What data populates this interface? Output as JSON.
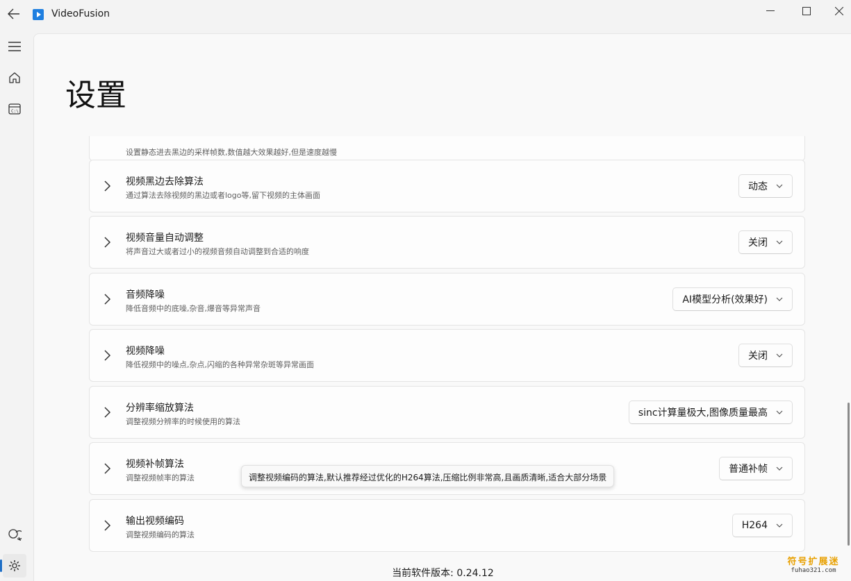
{
  "window": {
    "title": "VideoFusion"
  },
  "page": {
    "title": "设置"
  },
  "partial_card": {
    "desc": "设置静态进去黑边的采样帧数,数值越大效果越好,但是速度越慢"
  },
  "settings": [
    {
      "title": "视频黑边去除算法",
      "desc": "通过算法去除视频的黑边或者logo等,留下视频的主体画面",
      "value": "动态"
    },
    {
      "title": "视频音量自动调整",
      "desc": "将声音过大或者过小的视频音频自动调整到合适的响度",
      "value": "关闭"
    },
    {
      "title": "音频降噪",
      "desc": "降低音频中的底噪,杂音,爆音等异常声音",
      "value": "AI模型分析(效果好)"
    },
    {
      "title": "视频降噪",
      "desc": "降低视频中的噪点,杂点,闪缩的各种异常杂斑等异常画面",
      "value": "关闭"
    },
    {
      "title": "分辨率缩放算法",
      "desc": "调整视频分辨率的时候使用的算法",
      "value": "sinc计算量极大,图像质量最高"
    },
    {
      "title": "视频补帧算法",
      "desc": "调整视频帧率的算法",
      "value": "普通补帧"
    },
    {
      "title": "输出视频编码",
      "desc": "调整视频编码的算法",
      "value": "H264"
    }
  ],
  "tooltip": {
    "text": "调整视频编码的算法,默认推荐经过优化的H264算法,压缩比例非常高,且画质清晰,适合大部分场景"
  },
  "footer": {
    "version": "当前软件版本: 0.24.12"
  },
  "watermark": {
    "line1": "符号扩展迷",
    "line2": "fuhao321.com"
  },
  "icons": {
    "back": "back-arrow-icon",
    "menu": "hamburger-menu-icon",
    "home": "home-icon",
    "terminal": "terminal-window-icon",
    "feedback": "chat-feedback-icon",
    "settings": "gear-icon",
    "minimize": "minimize-icon",
    "maximize": "maximize-icon",
    "close": "close-icon",
    "chevron": "chevron-right-icon",
    "caret": "chevron-down-icon"
  },
  "colors": {
    "accent": "#1f6fc6",
    "app_icon": "#1f7fe0"
  }
}
